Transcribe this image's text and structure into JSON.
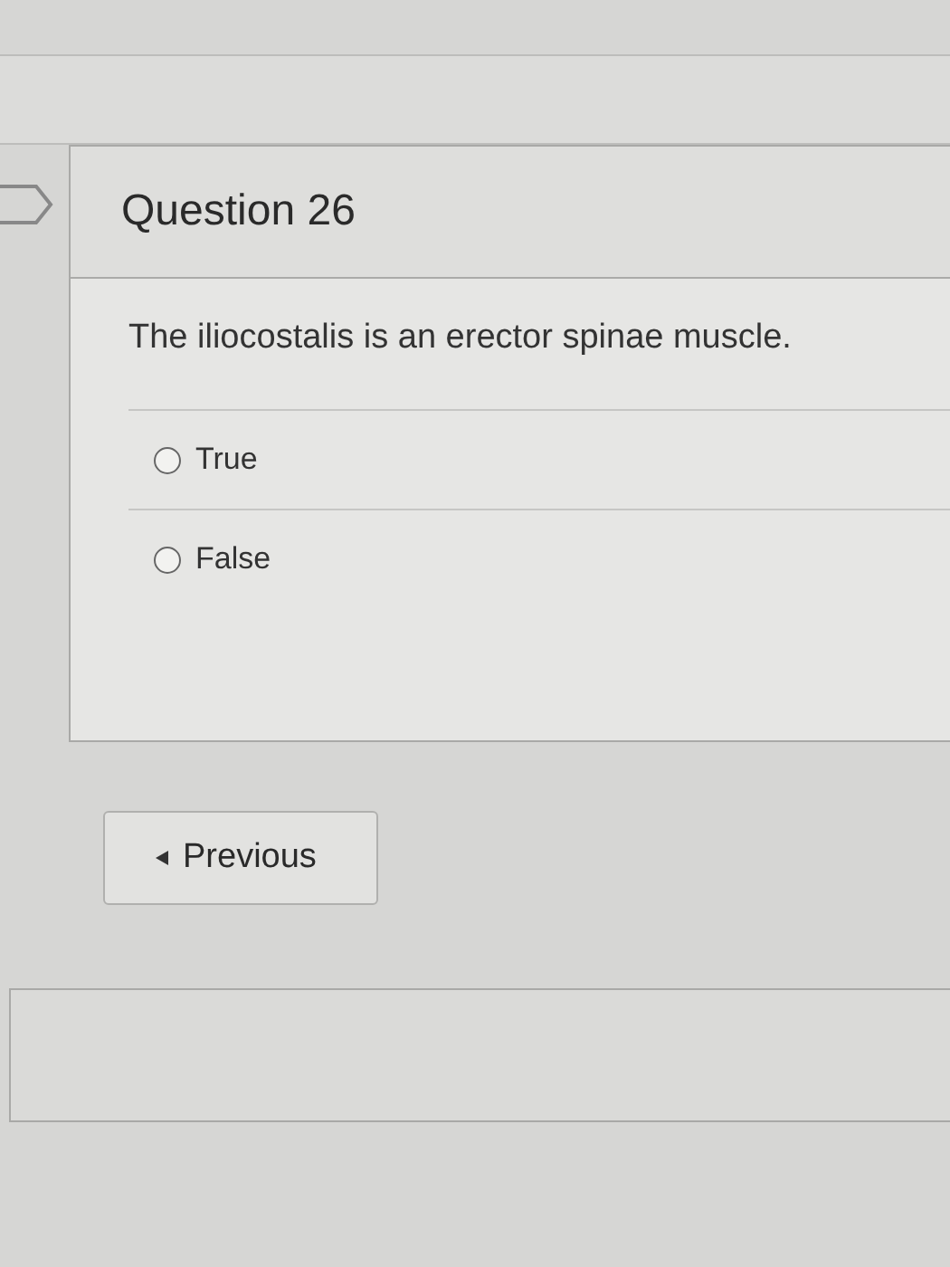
{
  "question": {
    "title": "Question 26",
    "text": "The iliocostalis is an erector spinae muscle.",
    "options": [
      {
        "label": "True",
        "selected": false
      },
      {
        "label": "False",
        "selected": false
      }
    ]
  },
  "buttons": [
    {
      "label": "Previous",
      "kind": "previous"
    }
  ]
}
